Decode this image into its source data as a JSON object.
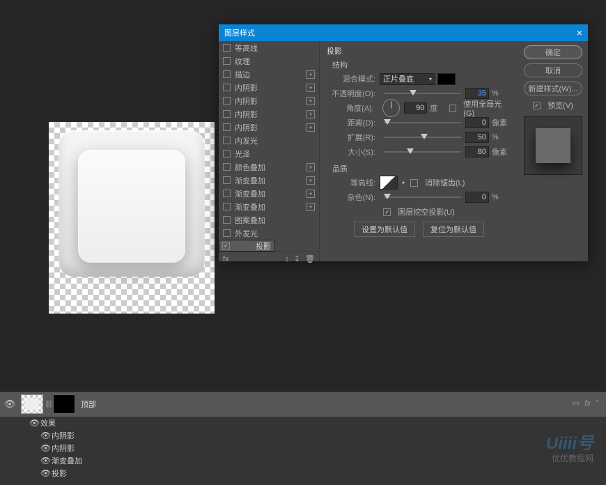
{
  "canvas": {},
  "dialog": {
    "title": "图层样式",
    "close": "×",
    "styles": [
      {
        "id": "contour",
        "label": "等高线",
        "checked": false,
        "btn": ""
      },
      {
        "id": "texture",
        "label": "纹理",
        "checked": false,
        "btn": ""
      },
      {
        "id": "stroke",
        "label": "描边",
        "checked": false,
        "btn": "+"
      },
      {
        "id": "inner-shadow",
        "label": "内阴影",
        "checked": false,
        "btn": "+"
      },
      {
        "id": "inner-shadow2",
        "label": "内阴影",
        "checked": false,
        "btn": "+"
      },
      {
        "id": "inner-shadow3",
        "label": "内阴影",
        "checked": false,
        "btn": "+"
      },
      {
        "id": "inner-shadow4",
        "label": "内阴影",
        "checked": false,
        "btn": "+"
      },
      {
        "id": "inner-glow",
        "label": "内发光",
        "checked": false,
        "btn": ""
      },
      {
        "id": "satin",
        "label": "光泽",
        "checked": false,
        "btn": ""
      },
      {
        "id": "color-overlay",
        "label": "颜色叠加",
        "checked": false,
        "btn": "+"
      },
      {
        "id": "gradient-overlay",
        "label": "渐变叠加",
        "checked": false,
        "btn": "+"
      },
      {
        "id": "gradient-overlay2",
        "label": "渐变叠加",
        "checked": false,
        "btn": "+"
      },
      {
        "id": "gradient-overlay3",
        "label": "渐变叠加",
        "checked": false,
        "btn": "+"
      },
      {
        "id": "pattern-overlay",
        "label": "图案叠加",
        "checked": false,
        "btn": ""
      },
      {
        "id": "outer-glow",
        "label": "外发光",
        "checked": false,
        "btn": ""
      },
      {
        "id": "drop-shadow",
        "label": "投影",
        "checked": true,
        "btn": "+",
        "selected": true
      }
    ],
    "fxrow": {
      "label": "fx",
      "icons": [
        "↕",
        "↧",
        "🗑"
      ]
    },
    "settings": {
      "title": "投影",
      "group1": "结构",
      "blend_label": "混合模式:",
      "blend_value": "正片叠底",
      "swatch_color": "#000000",
      "opacity_label": "不透明度(O):",
      "opacity_value": "35",
      "opacity_unit": "%",
      "angle_label": "角度(A):",
      "angle_value": "90",
      "angle_unit": "度",
      "global_label": "使用全局光(G)",
      "global_checked": false,
      "distance_label": "距离(D):",
      "distance_value": "0",
      "distance_unit": "像素",
      "spread_label": "扩展(R):",
      "spread_value": "50",
      "spread_unit": "%",
      "size_label": "大小(S):",
      "size_value": "80",
      "size_unit": "像素",
      "group2": "品质",
      "contour_label": "等高线:",
      "antialias_label": "消除锯齿(L)",
      "antialias_checked": false,
      "noise_label": "杂色(N):",
      "noise_value": "0",
      "noise_unit": "%",
      "knockout_label": "图层挖空投影(U)",
      "knockout_checked": true,
      "default_btn": "设置为默认值",
      "reset_btn": "复位为默认值"
    },
    "buttons": {
      "ok": "确定",
      "cancel": "取消",
      "new_style": "新建样式(W)...",
      "preview_label": "预览(V)",
      "preview_checked": true
    }
  },
  "layers": {
    "layer_name": "顶部",
    "fx_label": "fx",
    "effects_label": "效果",
    "subeffects": [
      "内阴影",
      "内阴影",
      "渐变叠加",
      "投影"
    ]
  },
  "watermark": {
    "main": "Uiiii号",
    "sub": "优优教程网"
  }
}
